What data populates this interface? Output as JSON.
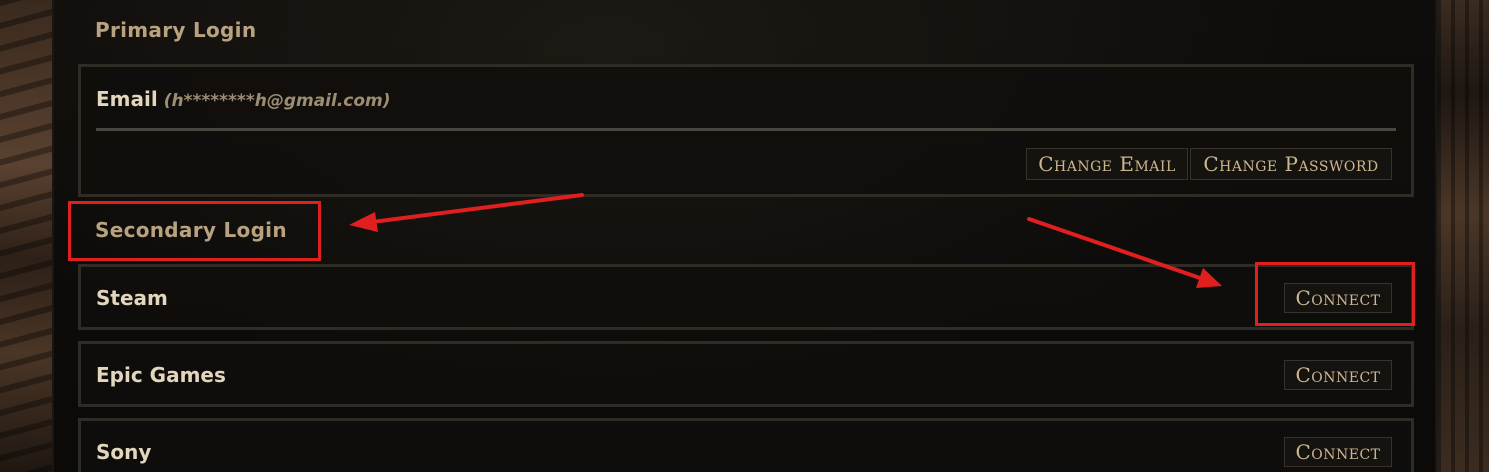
{
  "primary_login": {
    "heading": "Primary Login",
    "email_label": "Email",
    "email_value": "(h********h@gmail.com)",
    "change_email_label": "Change Email",
    "change_password_label": "Change Password"
  },
  "secondary_login": {
    "heading": "Secondary Login",
    "providers": [
      {
        "name": "Steam",
        "button_label": "Connect"
      },
      {
        "name": "Epic Games",
        "button_label": "Connect"
      },
      {
        "name": "Sony",
        "button_label": "Connect"
      }
    ]
  },
  "colors": {
    "heading": "#b9a27f",
    "label": "#e2d6bd",
    "button_text": "#cdb690",
    "annotation": "#e0201f"
  }
}
